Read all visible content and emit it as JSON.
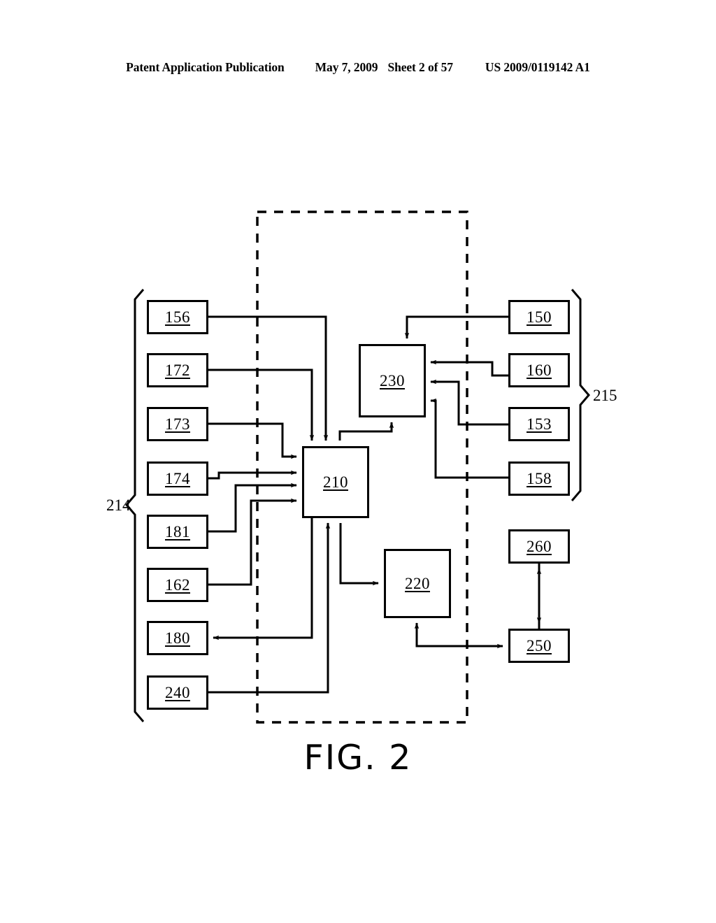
{
  "header": {
    "publication": "Patent Application Publication",
    "date": "May 7, 2009",
    "sheet": "Sheet 2 of 57",
    "patent_number": "US 2009/0119142 A1"
  },
  "figure": {
    "caption": "FIG. 2",
    "group_left_label": "214",
    "group_right_label": "215"
  },
  "nodes": {
    "n156": "156",
    "n172": "172",
    "n173": "173",
    "n174": "174",
    "n181": "181",
    "n162": "162",
    "n180": "180",
    "n240": "240",
    "n150": "150",
    "n160": "160",
    "n153": "153",
    "n158": "158",
    "n210": "210",
    "n230": "230",
    "n220": "220",
    "n260": "260",
    "n250": "250"
  },
  "diagram_data": {
    "type": "block-diagram",
    "title": "FIG. 2",
    "groups": [
      {
        "label": "214",
        "side": "left",
        "members": [
          "156",
          "172",
          "173",
          "174",
          "181",
          "162",
          "180",
          "240"
        ]
      },
      {
        "label": "215",
        "side": "right",
        "members": [
          "150",
          "160",
          "153",
          "158"
        ]
      }
    ],
    "dashed_boundary": {
      "style": "dashed",
      "encloses": [
        "210",
        "230",
        "220"
      ]
    },
    "edges": [
      {
        "from": "156",
        "to": "210",
        "direction": "to"
      },
      {
        "from": "172",
        "to": "210",
        "direction": "to"
      },
      {
        "from": "173",
        "to": "210",
        "direction": "to"
      },
      {
        "from": "174",
        "to": "210",
        "direction": "to"
      },
      {
        "from": "181",
        "to": "210",
        "direction": "to"
      },
      {
        "from": "162",
        "to": "210",
        "direction": "to"
      },
      {
        "from": "210",
        "to": "180",
        "direction": "to"
      },
      {
        "from": "240",
        "to": "210",
        "direction": "to"
      },
      {
        "from": "150",
        "to": "230",
        "direction": "to"
      },
      {
        "from": "160",
        "to": "230",
        "direction": "to"
      },
      {
        "from": "153",
        "to": "230",
        "direction": "to"
      },
      {
        "from": "158",
        "to": "230",
        "direction": "to"
      },
      {
        "from": "210",
        "to": "230",
        "direction": "to"
      },
      {
        "from": "210",
        "to": "220",
        "direction": "to"
      },
      {
        "from": "220",
        "to": "250",
        "direction": "to"
      },
      {
        "from": "250",
        "to": "260",
        "direction": "bidirectional"
      }
    ]
  }
}
